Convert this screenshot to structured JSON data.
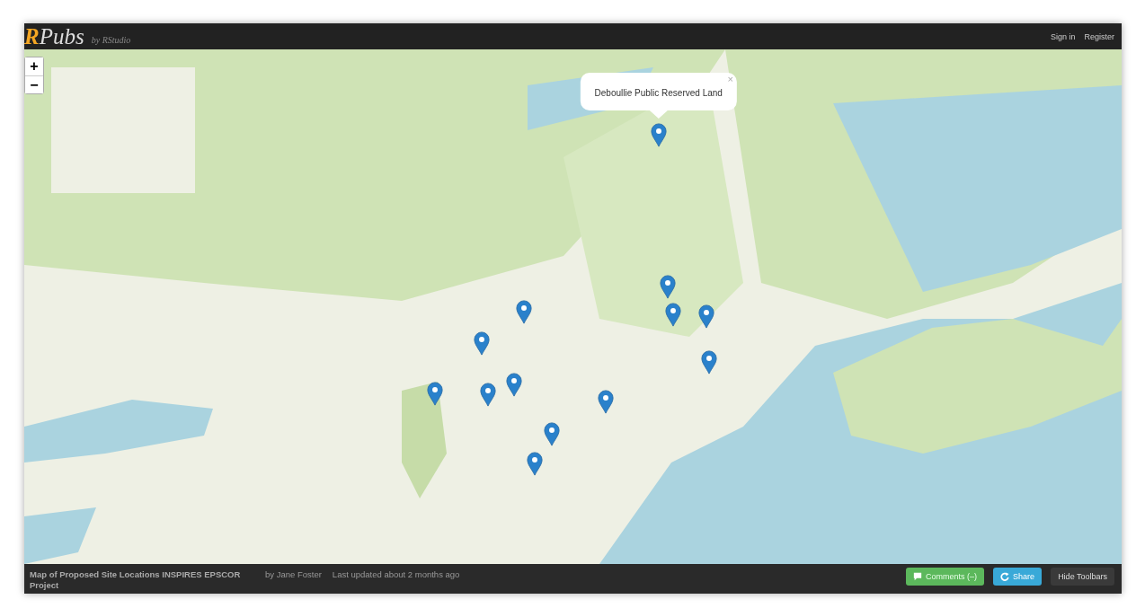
{
  "header": {
    "logo_letter": "R",
    "logo_rest": "Pubs",
    "byline": "by RStudio",
    "links": [
      {
        "label": "Sign in"
      },
      {
        "label": "Register"
      }
    ]
  },
  "map": {
    "zoom_in": "+",
    "zoom_out": "−",
    "popup": {
      "text": "Deboullie Public Reserved Land",
      "close": "×"
    }
  },
  "footer": {
    "title": "Map of Proposed Site Locations INSPIRES EPSCOR Project",
    "author": "by Jane Foster",
    "updated": "Last updated about 2 months ago",
    "buttons": [
      {
        "kind": "comments",
        "label": "Comments (–)"
      },
      {
        "kind": "share",
        "label": "Share"
      },
      {
        "kind": "plain",
        "label": "Hide Toolbars"
      }
    ]
  }
}
